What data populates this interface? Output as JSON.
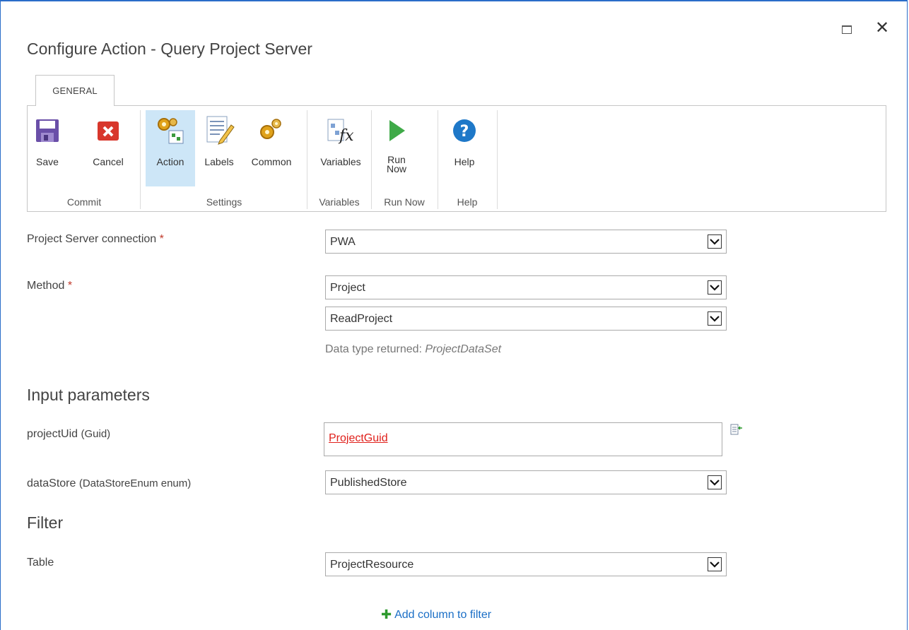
{
  "dialog": {
    "title": "Configure Action - Query Project Server"
  },
  "ribbon": {
    "tab": "GENERAL",
    "buttons": {
      "save": "Save",
      "cancel": "Cancel",
      "action": "Action",
      "labels": "Labels",
      "common": "Common",
      "variables": "Variables",
      "run_now_line1": "Run",
      "run_now_line2": "Now",
      "help": "Help"
    },
    "groups": {
      "commit": "Commit",
      "settings": "Settings",
      "variables": "Variables",
      "run_now": "Run Now",
      "help": "Help"
    }
  },
  "form": {
    "connection": {
      "label": "Project Server connection",
      "required": "*",
      "value": "PWA"
    },
    "method": {
      "label": "Method",
      "required": "*",
      "value1": "Project",
      "value2": "ReadProject"
    },
    "data_type": {
      "prefix": "Data type returned: ",
      "value": "ProjectDataSet"
    },
    "input_section": "Input parameters",
    "project_uid": {
      "label": "projectUid",
      "type": "(Guid)",
      "token": "ProjectGuid"
    },
    "data_store": {
      "label": "dataStore",
      "type": "(DataStoreEnum enum)",
      "value": "PublishedStore"
    },
    "filter_section": "Filter",
    "table": {
      "label": "Table",
      "value": "ProjectResource"
    },
    "add_column": "Add column to filter"
  },
  "colors": {
    "accent": "#2a6dc9",
    "required": "#c0392b",
    "token": "#e0201b",
    "link": "#1a6ec6",
    "active_button": "#cde6f7"
  }
}
